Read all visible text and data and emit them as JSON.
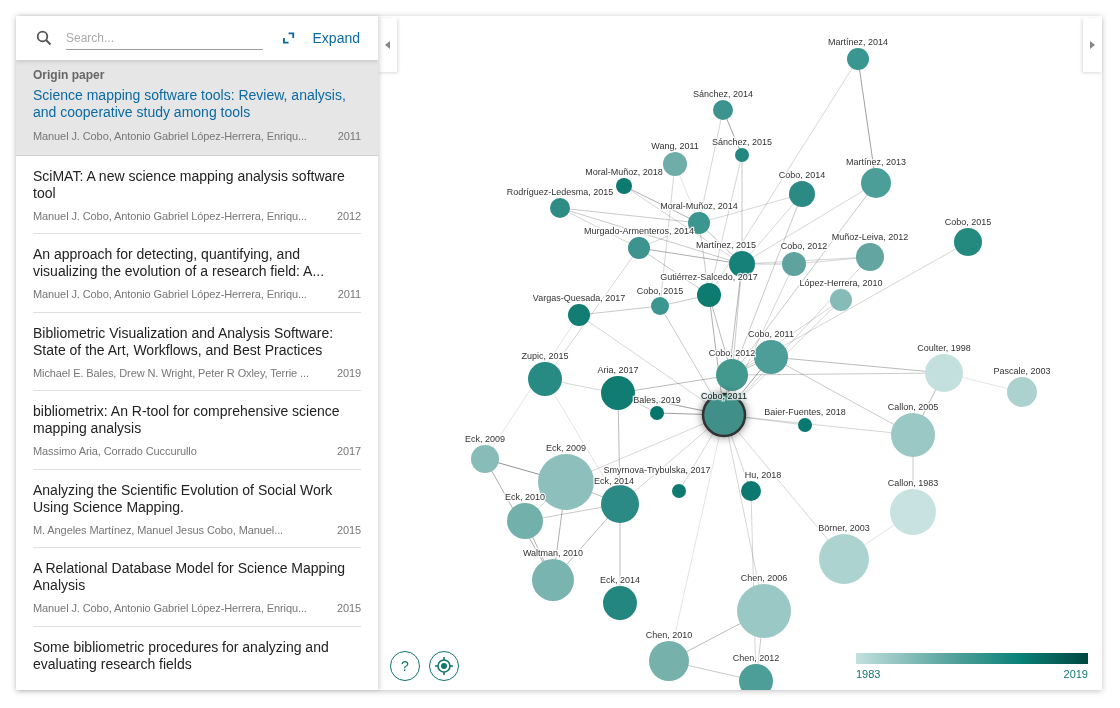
{
  "sidebar": {
    "search": {
      "placeholder": "Search..."
    },
    "expand_label": "Expand",
    "origin": {
      "heading": "Origin paper",
      "title": "Science mapping software tools: Review, analysis, and cooperative study among tools",
      "authors": "Manuel J. Cobo, Antonio Gabriel López-Herrera, Enriqu...",
      "year": "2011"
    },
    "papers": [
      {
        "title": "SciMAT: A new science mapping analysis software tool",
        "authors": "Manuel J. Cobo, Antonio Gabriel López-Herrera, Enriqu...",
        "year": "2012"
      },
      {
        "title": "An approach for detecting, quantifying, and visualizing the evolution of a research field: A...",
        "authors": "Manuel J. Cobo, Antonio Gabriel López-Herrera, Enriqu...",
        "year": "2011"
      },
      {
        "title": "Bibliometric Visualization and Analysis Software: State of the Art, Workflows, and Best Practices",
        "authors": "Michael E. Bales, Drew N. Wright, Peter R Oxley, Terrie ...",
        "year": "2019"
      },
      {
        "title": "bibliometrix: An R-tool for comprehensive science mapping analysis",
        "authors": "Massimo Aria, Corrado Cuccurullo",
        "year": "2017"
      },
      {
        "title": "Analyzing the Scientific Evolution of Social Work Using Science Mapping.",
        "authors": "M. Angeles Martínez, Manuel Jesus Cobo, Manuel...",
        "year": "2015"
      },
      {
        "title": "A Relational Database Model for Science Mapping Analysis",
        "authors": "Manuel J. Cobo, Antonio Gabriel López-Herrera, Enriqu...",
        "year": "2015"
      },
      {
        "title": "Some bibliometric procedures for analyzing and evaluating research fields"
      }
    ]
  },
  "graph": {
    "nodes": [
      {
        "label": "Martínez, 2014",
        "color": "#3a9690",
        "selected": false
      },
      {
        "label": "Sánchez, 2014",
        "color": "#3d938d",
        "selected": false
      },
      {
        "label": "Sánchez, 2015",
        "color": "#23877f",
        "selected": false
      },
      {
        "label": "Wang, 2011",
        "color": "#6fada8",
        "selected": false
      },
      {
        "label": "Moral-Muñoz, 2018",
        "color": "#0d7a70",
        "selected": false
      },
      {
        "label": "Rodríguez-Ledesma, 2015",
        "color": "#2e8c85",
        "selected": false
      },
      {
        "label": "Cobo, 2014",
        "color": "#2b8a83",
        "selected": false
      },
      {
        "label": "Martínez, 2013",
        "color": "#4c9e98",
        "selected": false
      },
      {
        "label": "Moral-Muñoz, 2014",
        "color": "#3b9690",
        "selected": false
      },
      {
        "label": "Murgado-Armenteros, 2014",
        "color": "#3d938d",
        "selected": false
      },
      {
        "label": "Martínez, 2015",
        "color": "#168179",
        "selected": false
      },
      {
        "label": "Cobo, 2012",
        "color": "#5fa39e",
        "selected": false
      },
      {
        "label": "Muñoz-Leiva, 2012",
        "color": "#63a5a0",
        "selected": false
      },
      {
        "label": "Cobo, 2015",
        "color": "#24897f",
        "selected": false
      },
      {
        "label": "Gutiérrez-Salcedo, 2017",
        "color": "#0e7b71",
        "selected": false
      },
      {
        "label": "Cobo, 2015",
        "color": "#3b9690",
        "selected": false
      },
      {
        "label": "López-Herrera, 2010",
        "color": "#86bbb7",
        "selected": false
      },
      {
        "label": "Vargas-Quesada, 2017",
        "color": "#117d73",
        "selected": false
      },
      {
        "label": "Cobo, 2011",
        "color": "#4d9e98",
        "selected": false
      },
      {
        "label": "Cobo, 2012",
        "color": "#44998f",
        "selected": false
      },
      {
        "label": "Zupic, 2015",
        "color": "#278a83",
        "selected": false
      },
      {
        "label": "Aria, 2017",
        "color": "#107c72",
        "selected": false
      },
      {
        "label": "Bales, 2019",
        "color": "#05756b",
        "selected": false
      },
      {
        "label": "Cobo, 2011",
        "color": "#3f8f89",
        "selected": true
      },
      {
        "label": "Baier-Fuentes, 2018",
        "color": "#097870",
        "selected": false
      },
      {
        "label": "Coulter, 1998",
        "color": "#c3e0de",
        "selected": false
      },
      {
        "label": "Pascale, 2003",
        "color": "#acd2cf",
        "selected": false
      },
      {
        "label": "Callon, 2005",
        "color": "#9ac8c4",
        "selected": false
      },
      {
        "label": "Eck, 2009",
        "color": "#87bcb8",
        "selected": false
      },
      {
        "label": "Eck, 2009",
        "color": "#8dc0bc",
        "selected": false
      },
      {
        "label": "Smyrnova-Trybulska, 2017",
        "color": "#0e7a71",
        "selected": false
      },
      {
        "label": "Hu, 2018",
        "color": "#0c786f",
        "selected": false
      },
      {
        "label": "Eck, 2014",
        "color": "#2b8a83",
        "selected": false
      },
      {
        "label": "Eck, 2010",
        "color": "#72b0ab",
        "selected": false
      },
      {
        "label": "Callon, 1983",
        "color": "#c7e2e0",
        "selected": false
      },
      {
        "label": "Börner, 2003",
        "color": "#add3d0",
        "selected": false
      },
      {
        "label": "Waltman, 2010",
        "color": "#7ab4b0",
        "selected": false
      },
      {
        "label": "Eck, 2014",
        "color": "#23877f",
        "selected": false
      },
      {
        "label": "Chen, 2006",
        "color": "#9ac8c4",
        "selected": false
      },
      {
        "label": "Chen, 2010",
        "color": "#76b1ac",
        "selected": false
      },
      {
        "label": "Chen, 2012",
        "color": "#4d9e98",
        "selected": false
      }
    ],
    "legend": {
      "min_label": "1983",
      "max_label": "2019"
    },
    "help_button": "?"
  }
}
